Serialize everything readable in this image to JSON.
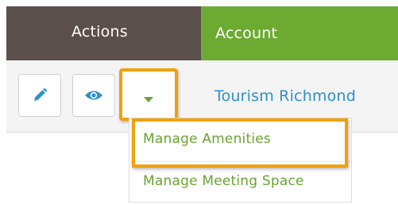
{
  "header": {
    "actions_label": "Actions",
    "account_label": "Account"
  },
  "row": {
    "account_name": "Tourism Richmond"
  },
  "dropdown": {
    "items": [
      {
        "label": "Manage Amenities"
      },
      {
        "label": "Manage Meeting Space"
      }
    ]
  },
  "colors": {
    "header_actions_bg": "#5a4f4b",
    "header_account_bg": "#6daa32",
    "link_blue": "#2b8fcc",
    "menu_green": "#6aa332",
    "highlight_orange": "#f0a10b"
  },
  "icons": {
    "edit": "pencil-icon",
    "view": "eye-icon",
    "menu": "caret-down-icon"
  }
}
